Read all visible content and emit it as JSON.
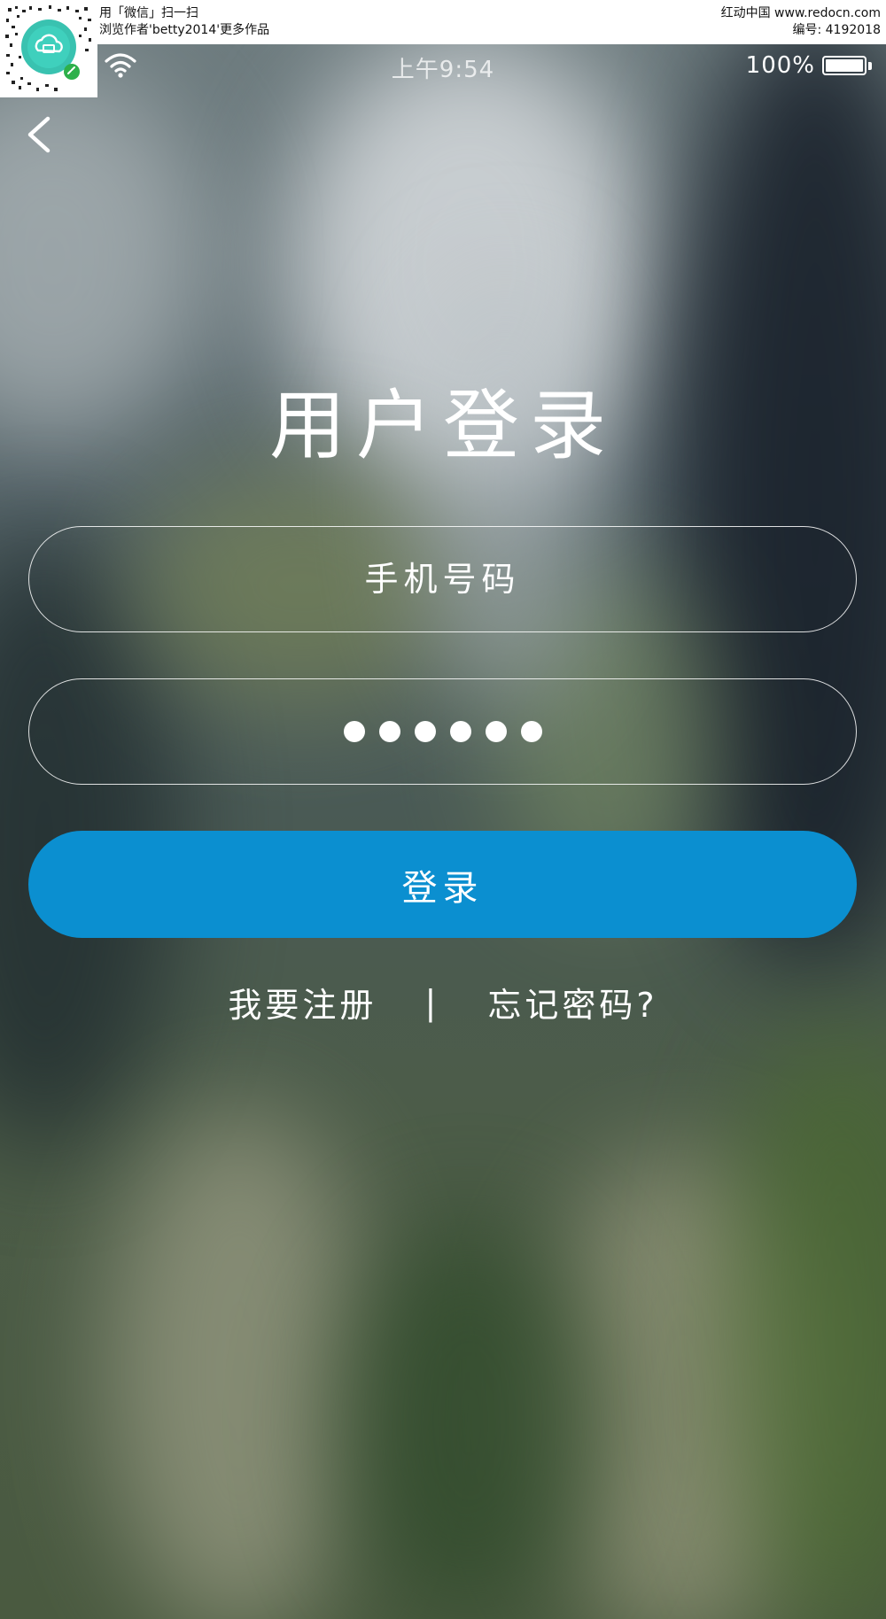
{
  "watermark": {
    "line1": "用「微信」扫一扫",
    "line2": "浏览作者'betty2014'更多作品",
    "site": "红动中国 www.redocn.com",
    "code": "编号: 4192018"
  },
  "status_bar": {
    "time": "上午9:54",
    "battery_percent": "100%",
    "battery_level": 1.0,
    "icons": [
      "wifi-icon",
      "battery-icon"
    ]
  },
  "nav": {
    "back_icon": "chevron-left-icon"
  },
  "page": {
    "title": "用户登录"
  },
  "form": {
    "phone_placeholder": "手机号码",
    "password_masked_count": 6,
    "login_label": "登录"
  },
  "links": {
    "register": "我要注册",
    "separator": "|",
    "forgot": "忘记密码?"
  },
  "colors": {
    "accent": "#0b8fd0",
    "text": "#ffffff"
  }
}
